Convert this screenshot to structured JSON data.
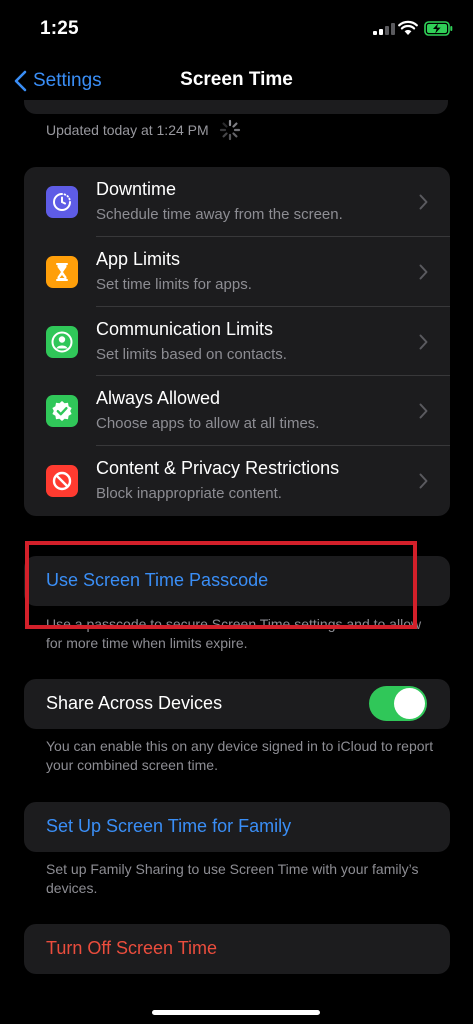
{
  "status_bar": {
    "time": "1:25",
    "signal_icon": "cellular-signal-icon",
    "wifi_icon": "wifi-icon",
    "battery_icon": "battery-charging-icon",
    "battery_color": "#30d158"
  },
  "nav": {
    "back_label": "Settings",
    "title": "Screen Time"
  },
  "updated_text": "Updated today at 1:24 PM",
  "menu_items": [
    {
      "icon": "downtime-icon",
      "color": "#5e5ce6",
      "title": "Downtime",
      "subtitle": "Schedule time away from the screen."
    },
    {
      "icon": "hourglass-icon",
      "color": "#ff9f0a",
      "title": "App Limits",
      "subtitle": "Set time limits for apps."
    },
    {
      "icon": "contact-person-icon",
      "color": "#30c759",
      "title": "Communication Limits",
      "subtitle": "Set limits based on contacts."
    },
    {
      "icon": "checkmark-seal-icon",
      "color": "#30c759",
      "title": "Always Allowed",
      "subtitle": "Choose apps to allow at all times."
    },
    {
      "icon": "no-entry-icon",
      "color": "#ff3b30",
      "title": "Content & Privacy Restrictions",
      "subtitle": "Block inappropriate content."
    }
  ],
  "passcode": {
    "label": "Use Screen Time Passcode",
    "footnote": "Use a passcode to secure Screen Time settings and to allow for more time when limits expire."
  },
  "share": {
    "label": "Share Across Devices",
    "enabled": true,
    "footnote": "You can enable this on any device signed in to iCloud to report your combined screen time."
  },
  "family": {
    "label": "Set Up Screen Time for Family",
    "footnote": "Set up Family Sharing to use Screen Time with your family’s devices."
  },
  "turn_off": {
    "label": "Turn Off Screen Time"
  },
  "colors": {
    "accent_blue": "#3a8ef6",
    "destructive_red": "#eb4d3d",
    "toggle_green": "#30c759",
    "highlight_red": "#d3202a"
  }
}
